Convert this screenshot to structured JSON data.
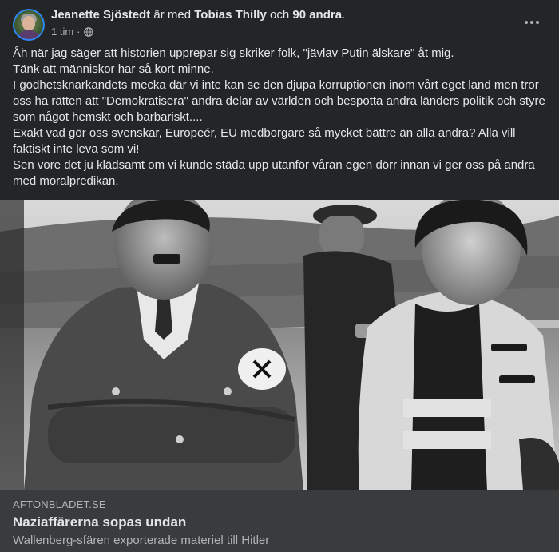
{
  "post": {
    "author": "Jeanette Sjöstedt",
    "with_word": "är med",
    "tagged": "Tobias Thilly",
    "and_word": "och",
    "others": "90 andra",
    "period": ".",
    "time": "1 tim",
    "separator": "·",
    "audience_icon": "globe-icon",
    "more_icon": "more-options-icon",
    "lines": [
      "Åh när jag säger att historien upprepar sig skriker folk, \"jävlav Putin älskare\" åt mig.",
      "Tänk att människor har så kort minne.",
      "I godhetsknarkandets mecka där vi inte kan se den djupa korruptionen inom vårt eget land men tror oss ha rätten att \"Demokratisera\" andra delar av världen och bespotta andra länders politik och styre som något hemskt och barbariskt....",
      "Exakt vad gör oss svenskar, Europeér, EU medborgare så mycket bättre än alla andra? Alla vill faktiskt inte leva som vi!",
      "Sen vore det ju klädsamt om vi kunde städa upp utanför våran egen dörr innan vi ger oss på andra med moralpredikan."
    ]
  },
  "link": {
    "domain": "AFTONBLADET.SE",
    "headline": "Naziaffärerna sopas undan",
    "description": "Wallenberg-sfären exporterade materiel till Hitler"
  },
  "colors": {
    "background": "#242526",
    "link_background": "#3a3b3c",
    "primary_text": "#e4e6eb",
    "secondary_text": "#b0b3b8"
  }
}
